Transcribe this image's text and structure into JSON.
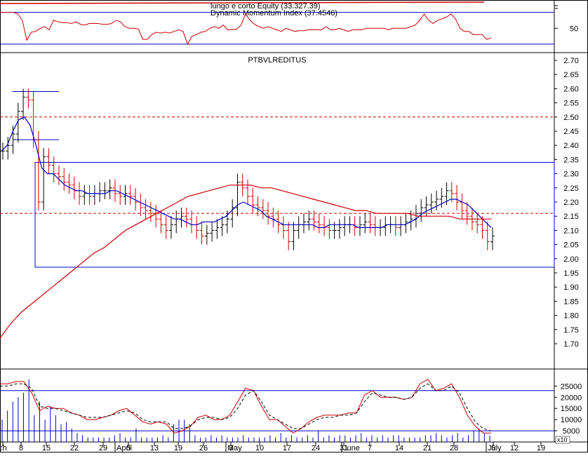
{
  "chart_data": [
    {
      "type": "line",
      "panel": "indicator",
      "title_line1": "lungo e corto Equity (33.327.39)",
      "title_line2": "Dynamic Momentum Index (37.4546)",
      "y_ticks": [
        "50"
      ],
      "reference_lines": [
        70,
        30
      ],
      "ylim": [
        22,
        82
      ],
      "series": [
        {
          "color": "#cc0000",
          "values": [
            70,
            70,
            70,
            70,
            68,
            60,
            35,
            45,
            46,
            50,
            52,
            48,
            60,
            58,
            57,
            57,
            56,
            58,
            55,
            54,
            56,
            56,
            56,
            55,
            55,
            56,
            60,
            58,
            52,
            50,
            50,
            49,
            36,
            36,
            42,
            45,
            44,
            45,
            44,
            46,
            48,
            46,
            30,
            40,
            42,
            45,
            46,
            50,
            52,
            50,
            54,
            48,
            48,
            49,
            54,
            68,
            60,
            55,
            52,
            50,
            52,
            50,
            48,
            46,
            50,
            48,
            46,
            47,
            47,
            48,
            48,
            48,
            48,
            52,
            48,
            48,
            50,
            48,
            46,
            48,
            48,
            48,
            50,
            50,
            50,
            50,
            50,
            48,
            50,
            50,
            50,
            50,
            52,
            54,
            60,
            68,
            60,
            56,
            60,
            62,
            64,
            68,
            62,
            50,
            46,
            46,
            42,
            42,
            42,
            36,
            38
          ]
        }
      ]
    },
    {
      "type": "line",
      "panel": "price",
      "title": "PTBVLREDITUS",
      "y_ticks": [
        "2.70",
        "2.65",
        "2.60",
        "2.55",
        "2.50",
        "2.45",
        "2.40",
        "2.35",
        "2.30",
        "2.25",
        "2.20",
        "2.15",
        "2.10",
        "2.05",
        "2.00",
        "1.95",
        "1.90",
        "1.85",
        "1.80",
        "1.75",
        "1.70"
      ],
      "ylim": [
        1.68,
        2.72
      ],
      "resistance_box": {
        "top": 2.34,
        "bottom": 1.97
      },
      "red_dashed_levels": [
        2.5,
        2.16
      ],
      "blue_levels": [
        2.59,
        2.42
      ],
      "series": [
        {
          "name": "bars",
          "color": "#000000",
          "values": [
            2.38,
            2.4,
            2.44,
            2.52,
            2.57,
            2.56,
            2.42,
            2.2,
            2.36,
            2.33,
            2.3,
            2.29,
            2.27,
            2.26,
            2.24,
            2.22,
            2.23,
            2.22,
            2.23,
            2.24,
            2.24,
            2.25,
            2.23,
            2.22,
            2.23,
            2.22,
            2.2,
            2.18,
            2.17,
            2.16,
            2.14,
            2.12,
            2.1,
            2.12,
            2.14,
            2.15,
            2.14,
            2.12,
            2.1,
            2.08,
            2.09,
            2.1,
            2.11,
            2.12,
            2.14,
            2.18,
            2.27,
            2.25,
            2.22,
            2.19,
            2.18,
            2.17,
            2.15,
            2.14,
            2.12,
            2.1,
            2.06,
            2.1,
            2.12,
            2.13,
            2.14,
            2.13,
            2.12,
            2.11,
            2.1,
            2.1,
            2.11,
            2.12,
            2.12,
            2.11,
            2.12,
            2.13,
            2.12,
            2.11,
            2.11,
            2.12,
            2.12,
            2.11,
            2.12,
            2.13,
            2.14,
            2.16,
            2.18,
            2.19,
            2.2,
            2.21,
            2.22,
            2.24,
            2.23,
            2.2,
            2.17,
            2.15,
            2.13,
            2.12,
            2.1,
            2.06,
            2.08
          ]
        },
        {
          "name": "ma-short",
          "color": "#0000cc",
          "values": [
            2.38,
            2.4,
            2.45,
            2.49,
            2.5,
            2.47,
            2.4,
            2.32,
            2.3,
            2.3,
            2.28,
            2.26,
            2.25,
            2.24,
            2.24,
            2.23,
            2.23,
            2.23,
            2.23,
            2.24,
            2.24,
            2.23,
            2.22,
            2.21,
            2.2,
            2.19,
            2.18,
            2.17,
            2.16,
            2.15,
            2.14,
            2.14,
            2.13,
            2.12,
            2.12,
            2.13,
            2.13,
            2.13,
            2.14,
            2.15,
            2.17,
            2.19,
            2.2,
            2.19,
            2.18,
            2.17,
            2.15,
            2.14,
            2.13,
            2.12,
            2.12,
            2.12,
            2.12,
            2.12,
            2.12,
            2.11,
            2.11,
            2.12,
            2.12,
            2.12,
            2.12,
            2.12,
            2.11,
            2.11,
            2.11,
            2.11,
            2.11,
            2.12,
            2.12,
            2.12,
            2.12,
            2.13,
            2.14,
            2.16,
            2.17,
            2.18,
            2.19,
            2.2,
            2.21,
            2.21,
            2.2,
            2.19,
            2.17,
            2.15,
            2.13,
            2.11
          ]
        },
        {
          "name": "ma-long",
          "color": "#cc0000",
          "values": [
            1.72,
            1.77,
            1.81,
            1.84,
            1.87,
            1.9,
            1.93,
            1.96,
            1.99,
            2.02,
            2.04,
            2.07,
            2.1,
            2.12,
            2.14,
            2.16,
            2.18,
            2.2,
            2.22,
            2.23,
            2.24,
            2.25,
            2.26,
            2.26,
            2.26,
            2.25,
            2.25,
            2.24,
            2.23,
            2.22,
            2.21,
            2.2,
            2.19,
            2.18,
            2.17,
            2.17,
            2.16,
            2.16,
            2.16,
            2.16,
            2.15,
            2.15,
            2.15,
            2.15,
            2.14,
            2.14,
            2.14,
            2.14
          ]
        }
      ]
    },
    {
      "type": "line",
      "panel": "volume",
      "y_ticks": [
        "25000",
        "20000",
        "15000",
        "10000",
        "5000"
      ],
      "y_tick_values": [
        25000,
        20000,
        15000,
        10000,
        5000
      ],
      "multiplier_label": "x10",
      "ylim": [
        0,
        32000
      ],
      "reference_lines": [
        23000,
        5000
      ],
      "x_ticks": [
        "ch",
        "8",
        "15",
        "22",
        "29",
        "5",
        "13",
        "19",
        "26",
        "3",
        "10",
        "17",
        "24",
        "31",
        "7",
        "14",
        "21",
        "28",
        "5",
        "12",
        "19"
      ],
      "month_labels": [
        "April",
        "May",
        "June",
        "July"
      ],
      "series": [
        {
          "name": "osc-red",
          "color": "#cc0000",
          "values": [
            26,
            26,
            27,
            27,
            22,
            14,
            16,
            15,
            15,
            13,
            12,
            10,
            10,
            11,
            12,
            14,
            15,
            12,
            9,
            8,
            9,
            8,
            4,
            5,
            7,
            11,
            12,
            10,
            10,
            12,
            18,
            24,
            23,
            16,
            10,
            10,
            7,
            4,
            6,
            9,
            11,
            12,
            12,
            12,
            13,
            13,
            21,
            23,
            20,
            20,
            20,
            19,
            20,
            26,
            28,
            23,
            24,
            26,
            20,
            12,
            7,
            4,
            4
          ]
        },
        {
          "name": "osc-dash",
          "color": "#000000",
          "values": [
            25,
            25,
            26,
            26,
            24,
            16,
            15,
            15,
            14,
            13,
            12,
            11,
            11,
            11,
            12,
            13,
            14,
            13,
            10,
            9,
            9,
            9,
            6,
            6,
            7,
            10,
            11,
            11,
            10,
            11,
            15,
            21,
            23,
            18,
            12,
            10,
            8,
            6,
            6,
            8,
            10,
            11,
            11,
            12,
            12,
            13,
            18,
            22,
            21,
            20,
            20,
            19,
            20,
            24,
            26,
            23,
            23,
            25,
            22,
            15,
            9,
            6,
            5
          ]
        },
        {
          "name": "volume-bars",
          "color": "#0000cc",
          "values": [
            10,
            14,
            18,
            20,
            22,
            28,
            12,
            18,
            10,
            16,
            12,
            8,
            9,
            6,
            4,
            3,
            2,
            2,
            2,
            2,
            2,
            3,
            4,
            2,
            2,
            6,
            2,
            2,
            2,
            2,
            3,
            2,
            8,
            10,
            10,
            8,
            3,
            2,
            2,
            3,
            2,
            3,
            2,
            2,
            2,
            3,
            2,
            2,
            2,
            2,
            3,
            2,
            4,
            2,
            3,
            2,
            2,
            3,
            2,
            5,
            2,
            3,
            2,
            3,
            3,
            2,
            3,
            4,
            2,
            3,
            2,
            3,
            2,
            3,
            3,
            2,
            2,
            2,
            2,
            3,
            3,
            4,
            3,
            2,
            3,
            4,
            2,
            3,
            5,
            6,
            4,
            3
          ]
        }
      ]
    }
  ]
}
